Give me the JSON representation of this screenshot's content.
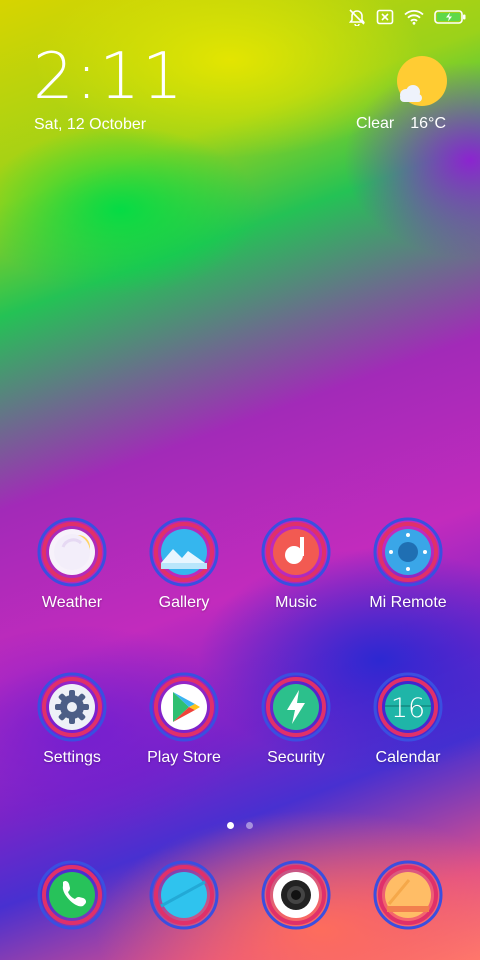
{
  "status_bar": {
    "icons": [
      "alarm-off-icon",
      "no-sim-icon",
      "wifi-icon",
      "battery-charging-icon"
    ]
  },
  "lockscreen": {
    "time": "2:11",
    "date": "Sat, 12 October"
  },
  "weather": {
    "condition": "Clear",
    "temperature": "16°C",
    "icon": "sun-cloud-icon"
  },
  "apps": [
    {
      "label": "Weather"
    },
    {
      "label": "Gallery"
    },
    {
      "label": "Music"
    },
    {
      "label": "Mi Remote"
    },
    {
      "label": "Settings"
    },
    {
      "label": "Play Store"
    },
    {
      "label": "Security"
    },
    {
      "label": "Calendar",
      "icon_text": "16"
    }
  ],
  "dock": [
    {
      "icon": "phone-icon"
    },
    {
      "icon": "messaging-icon"
    },
    {
      "icon": "camera-icon"
    },
    {
      "icon": "notes-icon"
    }
  ],
  "page_indicator": {
    "total": 2,
    "current": 1
  },
  "colors": {
    "ring_outer": "#3a4fe0",
    "ring_inner": "#e0306a",
    "sun": "#ffcc33"
  }
}
